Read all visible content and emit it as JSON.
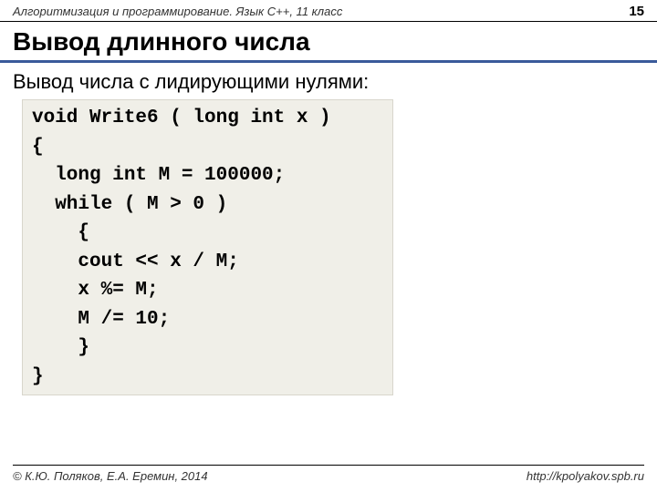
{
  "header": {
    "course": "Алгоритмизация и программирование. Язык С++, 11 класс",
    "page": "15"
  },
  "title": "Вывод длинного числа",
  "subtitle": "Вывод числа с лидирующими нулями:",
  "code": {
    "l1": "void Write6 ( long int x )",
    "l2": "{",
    "l3": "  long int M = 100000;",
    "l4": "  while ( M > 0 )",
    "l5": "    {",
    "l6": "    cout << x / M;",
    "l7": "    x %= M;",
    "l8": "    M /= 10;",
    "l9": "    }",
    "l10": "}"
  },
  "footer": {
    "copyright": "© К.Ю. Поляков, Е.А. Еремин, 2014",
    "url": "http://kpolyakov.spb.ru"
  }
}
